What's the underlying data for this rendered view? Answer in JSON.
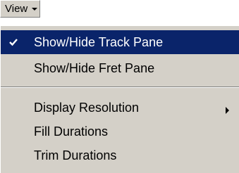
{
  "view_trigger": {
    "label": "View",
    "arrow_icon": "chevron-down-icon"
  },
  "menu": {
    "items": [
      {
        "label": "Show/Hide Track Pane",
        "checked": true,
        "selected": true,
        "has_submenu": false
      },
      {
        "label": "Show/Hide Fret Pane",
        "checked": false,
        "selected": false,
        "has_submenu": false
      },
      {
        "label": "Display Resolution",
        "checked": false,
        "selected": false,
        "has_submenu": true
      },
      {
        "label": "Fill Durations",
        "checked": false,
        "selected": false,
        "has_submenu": false
      },
      {
        "label": "Trim Durations",
        "checked": false,
        "selected": false,
        "has_submenu": false
      }
    ]
  },
  "colors": {
    "menu_background": "#d4d0c8",
    "selection_background": "#0a246a",
    "selection_text": "#ffffff",
    "text": "#000000"
  }
}
